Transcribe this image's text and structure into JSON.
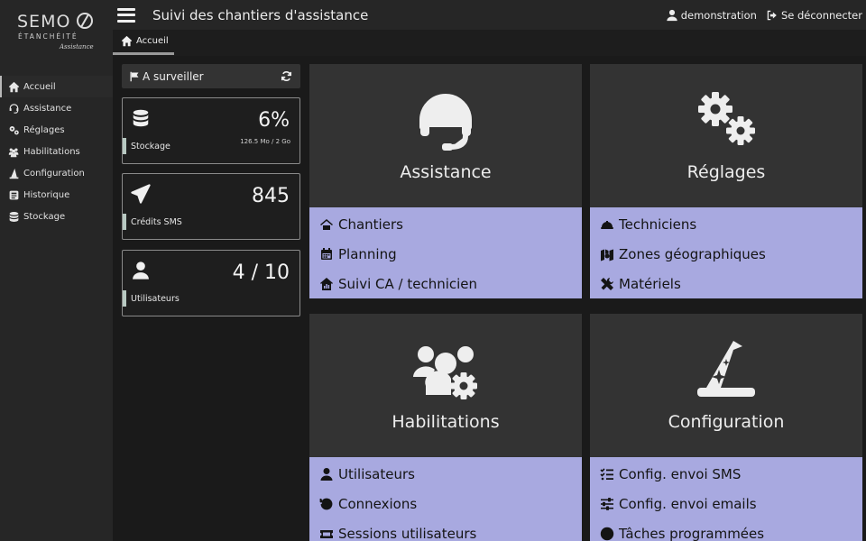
{
  "logo": {
    "text": "SEMO",
    "sub": "ÉTANCHÉITÉ",
    "script": "Assistance"
  },
  "header": {
    "title": "Suivi des chantiers d'assistance",
    "user": "demonstration",
    "logout": "Se déconnecter"
  },
  "tab": {
    "label": "Accueil"
  },
  "sidebar": {
    "items": [
      {
        "label": "Accueil",
        "icon": "home-icon"
      },
      {
        "label": "Assistance",
        "icon": "headset-icon"
      },
      {
        "label": "Réglages",
        "icon": "gears-icon"
      },
      {
        "label": "Habilitations",
        "icon": "users-icon"
      },
      {
        "label": "Configuration",
        "icon": "wizard-hat-icon"
      },
      {
        "label": "Historique",
        "icon": "history-icon"
      },
      {
        "label": "Stockage",
        "icon": "database-icon"
      }
    ]
  },
  "watch": {
    "label": "A surveiller"
  },
  "stats": {
    "storage": {
      "value": "6%",
      "sub": "126.5 Mo / 2 Go",
      "label": "Stockage"
    },
    "sms": {
      "value": "845",
      "label": "Crédits SMS"
    },
    "users": {
      "value": "4 / 10",
      "label": "Utilisateurs"
    }
  },
  "cards": {
    "assistance": {
      "title": "Assistance",
      "links": [
        "Chantiers",
        "Planning",
        "Suivi CA / technicien"
      ]
    },
    "reglages": {
      "title": "Réglages",
      "links": [
        "Techniciens",
        "Zones géographiques",
        "Matériels"
      ]
    },
    "habilitations": {
      "title": "Habilitations",
      "links": [
        "Utilisateurs",
        "Connexions",
        "Sessions utilisateurs"
      ]
    },
    "configuration": {
      "title": "Configuration",
      "links": [
        "Config. envoi SMS",
        "Config. envoi emails",
        "Tâches programmées"
      ]
    }
  },
  "colors": {
    "accent": "#a8a9e0",
    "card": "#333333",
    "background": "#1a1a1a"
  }
}
